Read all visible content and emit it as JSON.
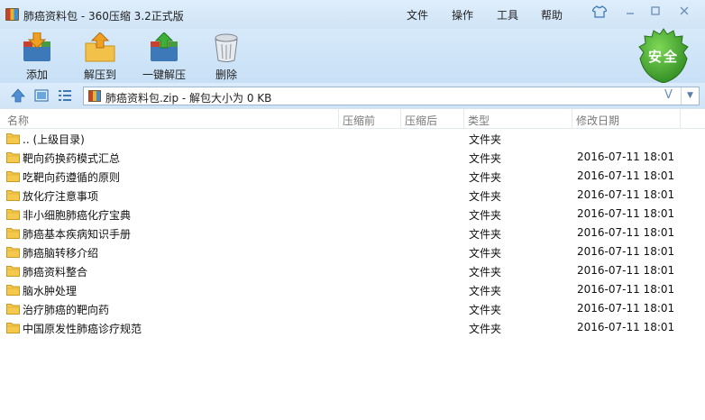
{
  "window": {
    "title": "肺癌资料包 - 360压缩 3.2正式版",
    "menu": [
      "文件",
      "操作",
      "工具",
      "帮助"
    ]
  },
  "toolbar": {
    "add_label": "添加",
    "extract_to_label": "解压到",
    "one_click_extract_label": "一键解压",
    "delete_label": "删除",
    "security_badge": "安全"
  },
  "address": {
    "path": "肺癌资料包.zip - 解包大小为 0 KB",
    "suffix": "V"
  },
  "columns": {
    "name": "名称",
    "compressed_before": "压缩前",
    "compressed_after": "压缩后",
    "type": "类型",
    "modified": "修改日期"
  },
  "rows": [
    {
      "name": ".. (上级目录)",
      "type": "文件夹",
      "modified": ""
    },
    {
      "name": "靶向药换药模式汇总",
      "type": "文件夹",
      "modified": "2016-07-11 18:01"
    },
    {
      "name": "吃靶向药遵循的原则",
      "type": "文件夹",
      "modified": "2016-07-11 18:01"
    },
    {
      "name": "放化疗注意事项",
      "type": "文件夹",
      "modified": "2016-07-11 18:01"
    },
    {
      "name": "非小细胞肺癌化疗宝典",
      "type": "文件夹",
      "modified": "2016-07-11 18:01"
    },
    {
      "name": "肺癌基本疾病知识手册",
      "type": "文件夹",
      "modified": "2016-07-11 18:01"
    },
    {
      "name": "肺癌脑转移介绍",
      "type": "文件夹",
      "modified": "2016-07-11 18:01"
    },
    {
      "name": "肺癌资料整合",
      "type": "文件夹",
      "modified": "2016-07-11 18:01"
    },
    {
      "name": "脑水肿处理",
      "type": "文件夹",
      "modified": "2016-07-11 18:01"
    },
    {
      "name": "治疗肺癌的靶向药",
      "type": "文件夹",
      "modified": "2016-07-11 18:01"
    },
    {
      "name": "中国原发性肺癌诊疗规范",
      "type": "文件夹",
      "modified": "2016-07-11 18:01"
    }
  ]
}
